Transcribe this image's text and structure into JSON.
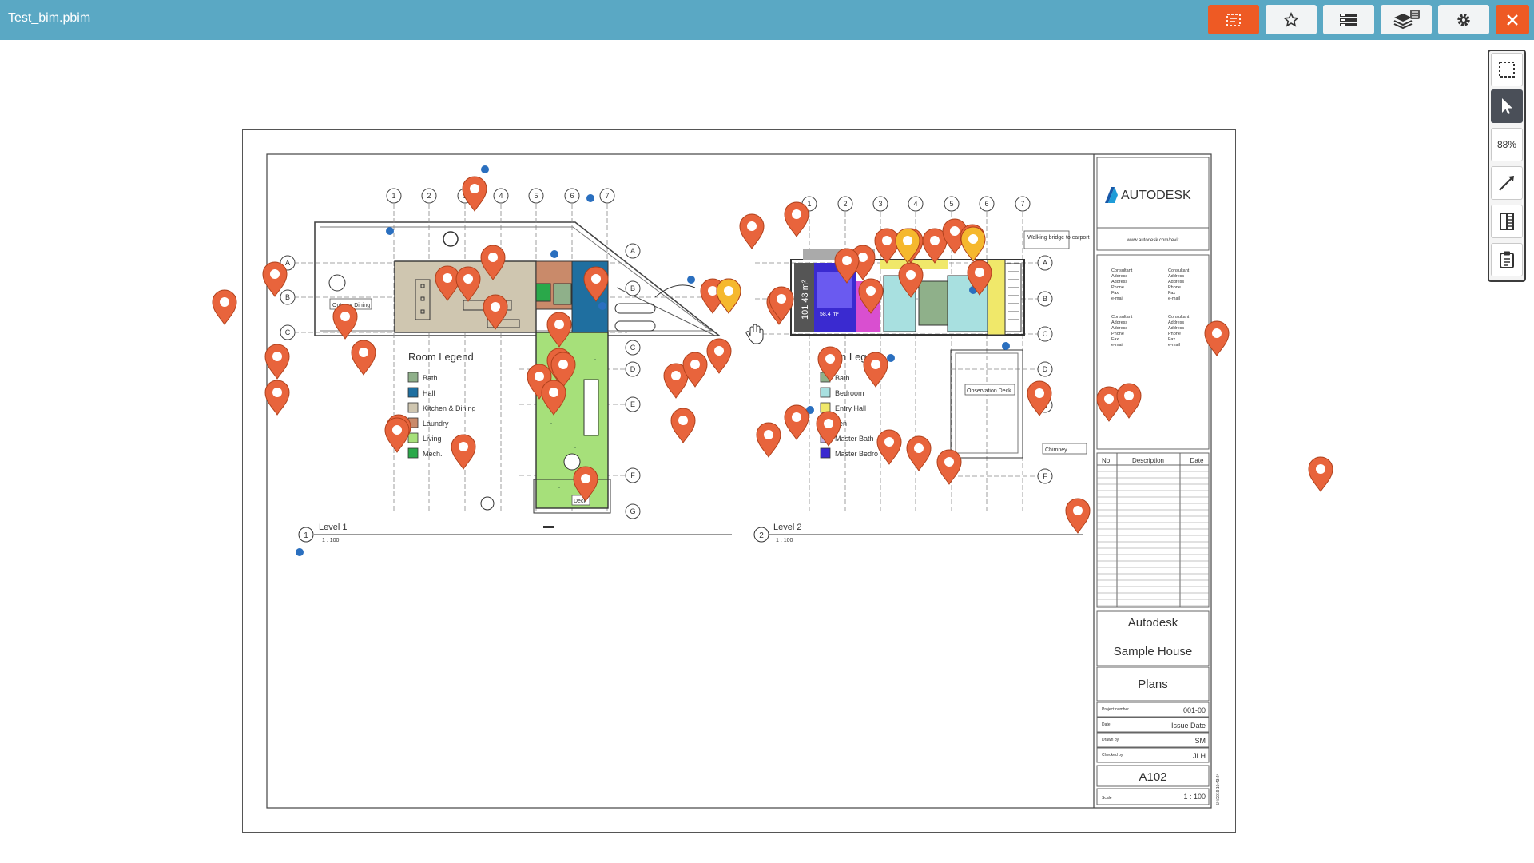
{
  "app": {
    "title": "Test_bim.pbim"
  },
  "toolbar": {
    "buttons": [
      {
        "name": "markup-mode-button",
        "icon": "markup-icon",
        "active": true
      },
      {
        "name": "favorites-button",
        "icon": "star-icon"
      },
      {
        "name": "list-button",
        "icon": "list-icon"
      },
      {
        "name": "layers-button",
        "icon": "layers-icon"
      },
      {
        "name": "settings-button",
        "icon": "gear-icon"
      },
      {
        "name": "close-button",
        "icon": "close-icon"
      }
    ]
  },
  "right_tools": {
    "zoom_label": "88%"
  },
  "sheet": {
    "level1": {
      "number": "1",
      "title": "Level 1",
      "scale": "1 : 100"
    },
    "level2": {
      "number": "2",
      "title": "Level 2",
      "scale": "1 : 100"
    },
    "legend1": {
      "title": "Room Legend",
      "items": [
        {
          "label": "Bath",
          "color": "#8fb08a"
        },
        {
          "label": "Hall",
          "color": "#1f6fa0"
        },
        {
          "label": "Kitchen & Dining",
          "color": "#cfc6b0"
        },
        {
          "label": "Laundry",
          "color": "#c98a6a"
        },
        {
          "label": "Living",
          "color": "#a6e07a"
        },
        {
          "label": "Mech.",
          "color": "#2aa84a"
        }
      ]
    },
    "legend2": {
      "title": "n Leg",
      "items": [
        {
          "label": "Bath",
          "color": "#8fb08a"
        },
        {
          "label": "Bedroom",
          "color": "#a8e0e0"
        },
        {
          "label": "Entry Hall",
          "color": "#f0e86a"
        },
        {
          "label": "hen",
          "color": "#d94fd0"
        },
        {
          "label": "Master Bath",
          "color": "#c0b0e0"
        },
        {
          "label": "Master Bedro",
          "color": "#3a2ad0"
        }
      ]
    },
    "grid_top_l1": [
      "1",
      "2",
      "3",
      "4",
      "5",
      "6",
      "7"
    ],
    "grid_top_l2": [
      "1",
      "2",
      "3",
      "4",
      "5",
      "6",
      "7"
    ],
    "grid_side_l1": [
      "A",
      "B",
      "C",
      "D",
      "E",
      "F",
      "G"
    ],
    "grid_side_left": [
      "A",
      "B",
      "C"
    ],
    "grid_side_l2": [
      "A",
      "B",
      "C",
      "D",
      "E",
      "F"
    ],
    "callouts": {
      "walk": "Walking bridge to carport",
      "obs": "Observation Deck",
      "chimney": "Chimney",
      "outdoor": "Outdoor Dining",
      "deck": "Deck"
    },
    "title_block": {
      "brand": "AUTODESK",
      "url": "www.autodesk.com/revit",
      "consultant_lines": [
        "Consultant",
        "Address",
        "Address",
        "Phone",
        "Fax",
        "e-mail"
      ],
      "rev_headers": [
        "No.",
        "Description",
        "Date"
      ],
      "company": "Autodesk",
      "project": "Sample House",
      "sheet_name": "Plans",
      "fields": [
        {
          "label": "Project number",
          "value": "001-00"
        },
        {
          "label": "Date",
          "value": "Issue Date"
        },
        {
          "label": "Drawn by",
          "value": "SM"
        },
        {
          "label": "Checked by",
          "value": "JLH"
        }
      ],
      "sheet_number": "A102",
      "scale_label": "Scale",
      "scale_value": "1 : 100",
      "stamp": "5/4/2019 10:43:24"
    }
  }
}
